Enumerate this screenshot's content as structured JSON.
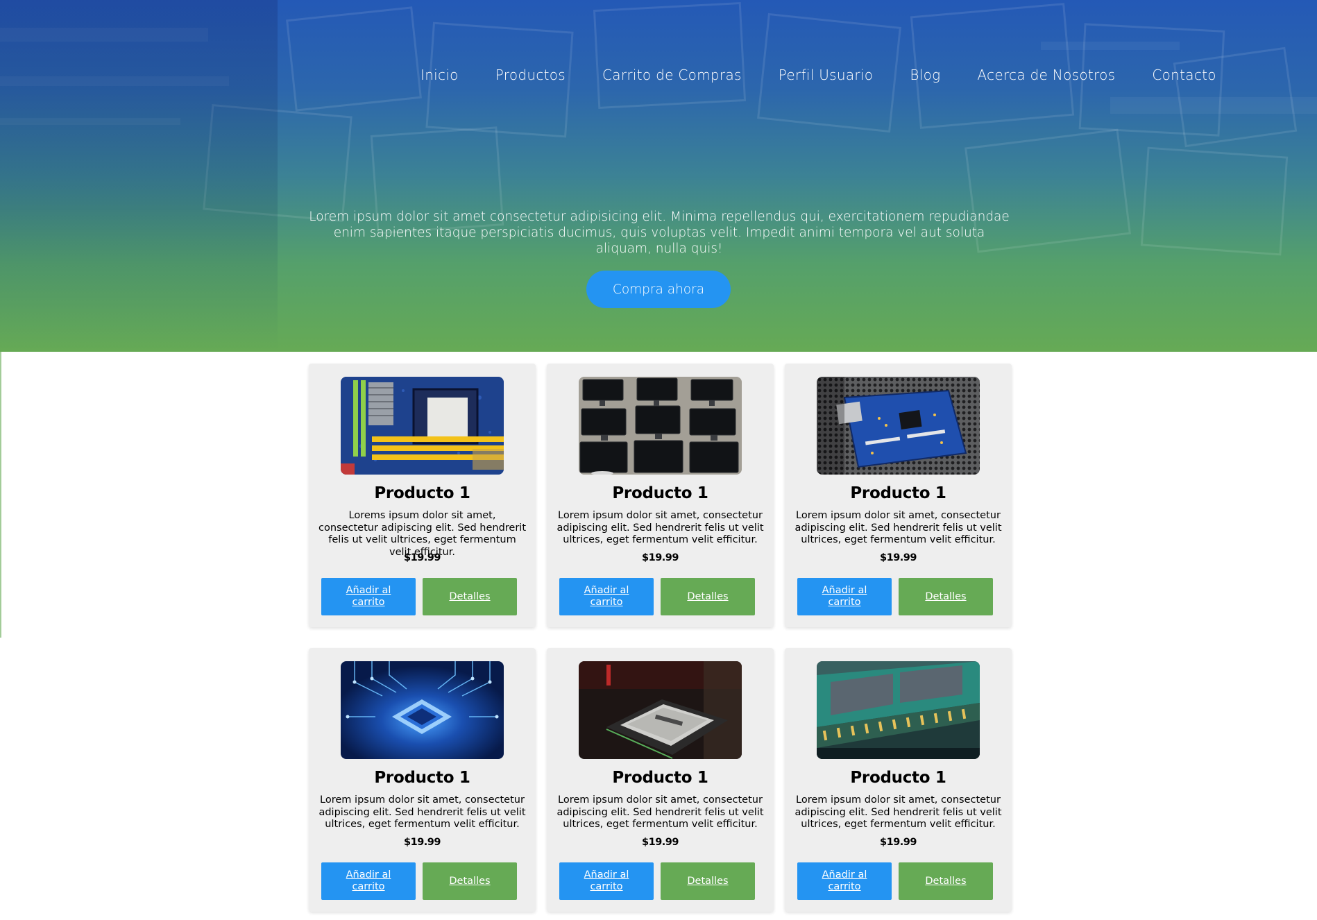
{
  "nav": {
    "items": [
      {
        "label": "Inicio"
      },
      {
        "label": "Productos"
      },
      {
        "label": "Carrito de Compras"
      },
      {
        "label": "Perfil Usuario"
      },
      {
        "label": "Blog"
      },
      {
        "label": "Acerca de Nosotros"
      },
      {
        "label": "Contacto"
      }
    ]
  },
  "hero": {
    "text": "Lorem ipsum dolor sit amet consectetur adipisicing elit. Minima repellendus qui, exercitationem repudiandae enim sapientes itaque perspiciatis ducimus, quis voluptas velit. Impedit animi tempora vel aut soluta aliquam, nulla quis!",
    "cta_label": "Compra ahora"
  },
  "colors": {
    "accent_blue": "#2494f2",
    "accent_green": "#66aa55",
    "card_bg": "#eeeeee"
  },
  "products": [
    {
      "image": "motherboard-image",
      "title": "Producto 1",
      "description": "Lorems ipsum dolor sit amet, consectetur adipiscing elit. Sed hendrerit felis ut velit ultrices, eget fermentum velit efficitur.",
      "price": "$19.99",
      "add_label": "Añadir al carrito",
      "details_label": "Detalles"
    },
    {
      "image": "monitors-image",
      "title": "Producto 1",
      "description": "Lorem ipsum dolor sit amet, consectetur adipiscing elit. Sed hendrerit felis ut velit ultrices, eget fermentum velit efficitur.",
      "price": "$19.99",
      "add_label": "Añadir al carrito",
      "details_label": "Detalles"
    },
    {
      "image": "circuit-board-image",
      "title": "Producto 1",
      "description": "Lorem ipsum dolor sit amet, consectetur adipiscing elit. Sed hendrerit felis ut velit ultrices, eget fermentum velit efficitur.",
      "price": "$19.99",
      "add_label": "Añadir al carrito",
      "details_label": "Detalles"
    },
    {
      "image": "chip-image",
      "title": "Producto 1",
      "description": "Lorem ipsum dolor sit amet, consectetur adipiscing elit. Sed hendrerit felis ut velit ultrices, eget fermentum velit efficitur.",
      "price": "$19.99",
      "add_label": "Añadir al carrito",
      "details_label": "Detalles"
    },
    {
      "image": "cpu-image",
      "title": "Producto 1",
      "description": "Lorem ipsum dolor sit amet, consectetur adipiscing elit. Sed hendrerit felis ut velit ultrices, eget fermentum velit efficitur.",
      "price": "$19.99",
      "add_label": "Añadir al carrito",
      "details_label": "Detalles"
    },
    {
      "image": "ram-image",
      "title": "Producto 1",
      "description": "Lorem ipsum dolor sit amet, consectetur adipiscing elit. Sed hendrerit felis ut velit ultrices, eget fermentum velit efficitur.",
      "price": "$19.99",
      "add_label": "Añadir al carrito",
      "details_label": "Detalles"
    }
  ]
}
